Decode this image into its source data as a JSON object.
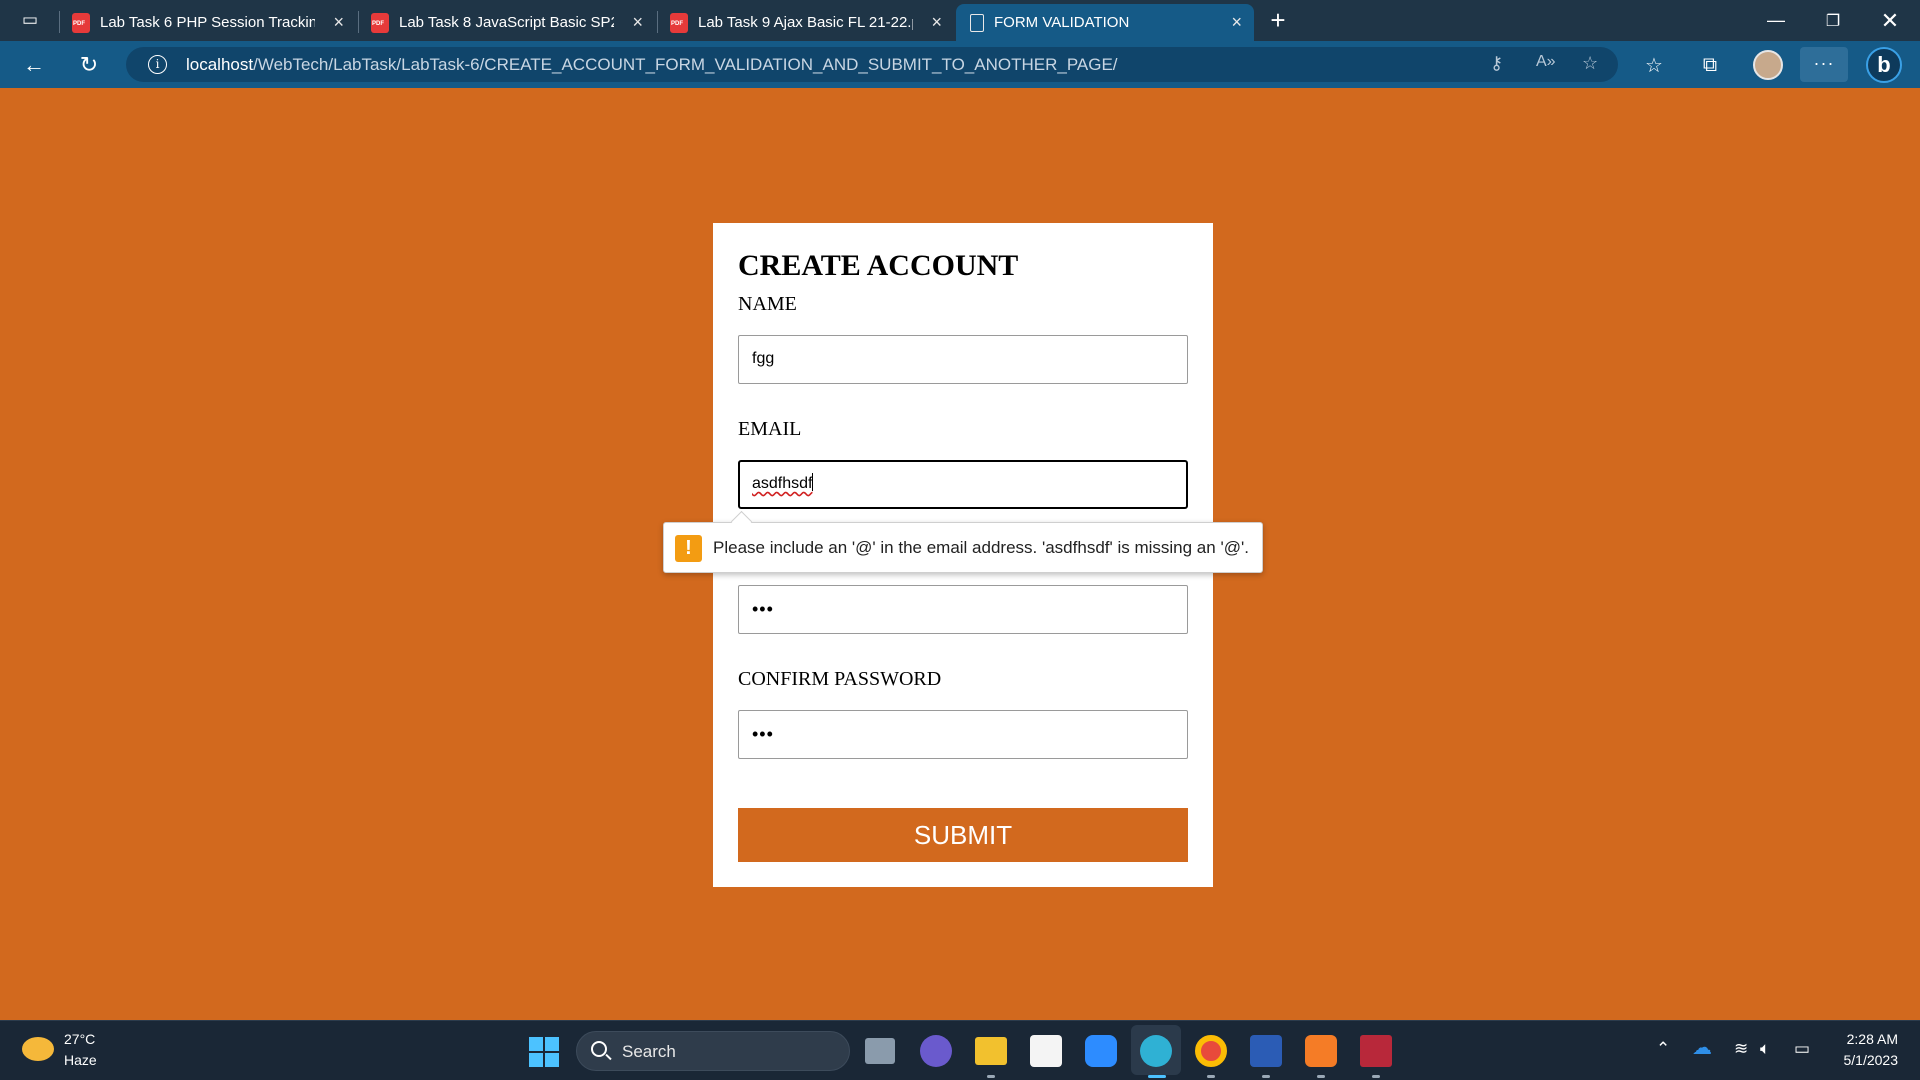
{
  "browser": {
    "tabs": [
      {
        "title": "Lab Task 6 PHP Session Tracking",
        "icon": "pdf-icon"
      },
      {
        "title": "Lab Task 8 JavaScript Basic SP21-",
        "icon": "pdf-icon"
      },
      {
        "title": "Lab Task 9 Ajax Basic FL 21-22.pd",
        "icon": "pdf-icon"
      },
      {
        "title": "FORM VALIDATION",
        "icon": "document-icon",
        "active": true
      }
    ],
    "url_host": "localhost",
    "url_path": "/WebTech/LabTask/LabTask-6/CREATE_ACCOUNT_FORM_VALIDATION_AND_SUBMIT_TO_ANOTHER_PAGE/",
    "more_label": "···",
    "accent": "#155a87"
  },
  "form": {
    "title": "CREATE ACCOUNT",
    "name_label": "NAME",
    "name_value": "fgg",
    "email_label": "EMAIL",
    "email_value": "asdfhsdf",
    "password_value": "•••",
    "confirm_label": "CONFIRM PASSWORD",
    "confirm_value": "•••",
    "submit_label": "SUBMIT",
    "page_color": "#d2691e"
  },
  "validation": {
    "message": "Please include an '@' in the email address. 'asdfhsdf' is missing an '@'.",
    "icon": "warning-icon",
    "icon_glyph": "!"
  },
  "taskbar": {
    "temperature": "27°C",
    "weather": "Haze",
    "search_label": "Search",
    "time": "2:28 AM",
    "date": "5/1/2023"
  }
}
